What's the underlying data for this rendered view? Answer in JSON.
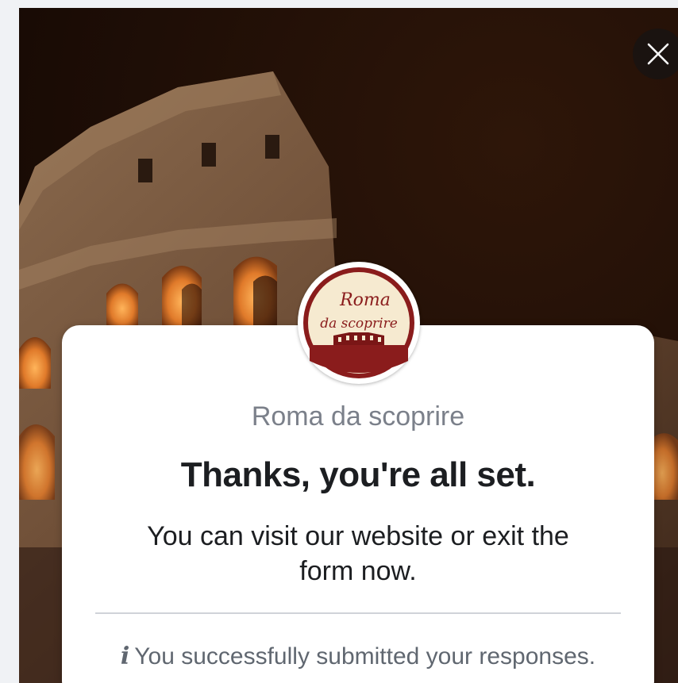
{
  "page": {
    "name": "Roma da scoprire",
    "logo_text_line1": "Roma",
    "logo_text_line2": "da scoprire"
  },
  "confirmation": {
    "headline": "Thanks, you're all set.",
    "message": "You can visit our website or exit the form now.",
    "status_icon": "i",
    "status_text": "You successfully submitted your responses."
  },
  "icons": {
    "close": "close-icon",
    "info": "info-icon"
  },
  "colors": {
    "logo_maroon": "#8a1c1c",
    "logo_cream": "#f6ead0"
  }
}
